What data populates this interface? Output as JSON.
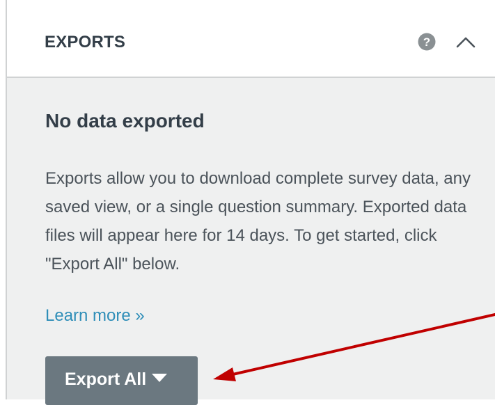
{
  "header": {
    "title": "EXPORTS",
    "help_icon": "question-circle-icon",
    "collapse_icon": "chevron-up-icon"
  },
  "body": {
    "title": "No data exported",
    "description": "Exports allow you to download complete survey data, any saved view, or a single question summary. Exported data files will appear here for 14 days. To get started, click \"Export All\" below.",
    "learn_more": "Learn more »",
    "export_button": "Export All",
    "export_caret_icon": "caret-down-icon"
  },
  "annotation": {
    "arrow_color": "#c00000"
  },
  "colors": {
    "panel_bg": "#eff0f0",
    "button_bg": "#6b7880",
    "link": "#2f8eb8",
    "title": "#333e48"
  }
}
